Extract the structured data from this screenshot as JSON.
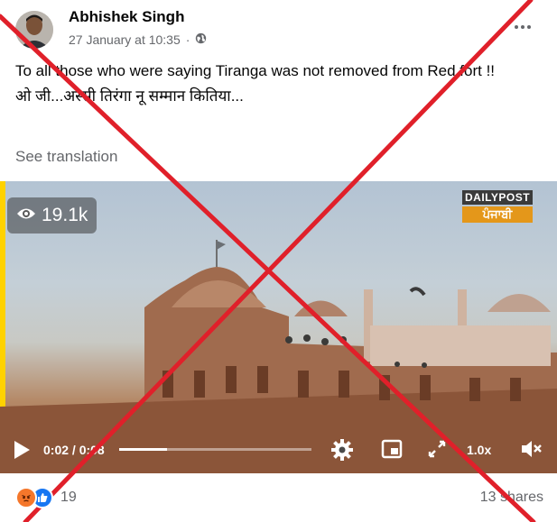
{
  "post": {
    "author_name": "Abhishek Singh",
    "timestamp": "27 January at 10:35",
    "audience_icon": "globe-icon",
    "text_line1": "To all those who were saying Tiranga was not  removed from Red fort !!",
    "text_line2": "ओ जी...अस्सी तिरंगा नू सम्मान कितिया...",
    "see_translation": "See translation"
  },
  "video": {
    "views": "19.1k",
    "logo_top": "DAILYPOST",
    "logo_bottom": "ਪੰਜਾਬੀ",
    "time_current": "0:02",
    "time_total": "0:08",
    "time_display": "0:02 / 0:08",
    "progress_fraction": 0.25,
    "speed": "1.0x"
  },
  "footer": {
    "reaction_count": "19",
    "shares": "13 shares"
  },
  "colors": {
    "overlay_cross": "#e0202a",
    "secondary_text": "#65676b",
    "angry_reaction": "#f5772b",
    "like_reaction": "#1877f2"
  }
}
